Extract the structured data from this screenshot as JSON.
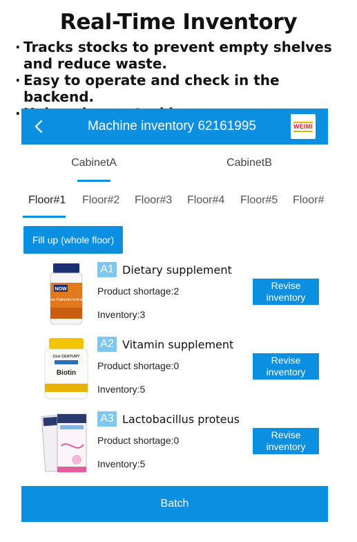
{
  "promo": {
    "title": "Real-Time Inventory",
    "bullets": [
      "Tracks stocks to prevent empty shelves and reduce waste.",
      "Easy to operate and check in the backend.",
      "Helps plan restocking"
    ]
  },
  "header": {
    "title": "Machine inventory 62161995",
    "logo_text": "WEIMI",
    "accent_color": "#0b8fe0"
  },
  "cabinet_tabs": [
    "CabinetA",
    "CabinetB"
  ],
  "selected_cabinet": "CabinetA",
  "floor_tabs": [
    "Floor#1",
    "Floor#2",
    "Floor#3",
    "Floor#4",
    "Floor#5",
    "Floor#"
  ],
  "selected_floor": "Floor#1",
  "fill_button_label": "Fill up (whole floor)",
  "products": [
    {
      "slot": "A1",
      "name": "Dietary supplement",
      "shortage": "Product shortage:2",
      "inventory": "Inventory:3",
      "revise_label": "Revise inventory",
      "image_icon": "supplement-bottle-icon",
      "image_text": [
        "NOW",
        "Saw Palmetto Extract"
      ]
    },
    {
      "slot": "A2",
      "name": "Vitamin supplement",
      "shortage": "Product shortage:0",
      "inventory": "Inventory:5",
      "revise_label": "Revise inventory",
      "image_icon": "vitamin-bottle-icon",
      "image_text": [
        "21st CENTURY",
        "Biotin"
      ]
    },
    {
      "slot": "A3",
      "name": "Lactobacillus proteus",
      "shortage": "Product shortage:0",
      "inventory": "Inventory:5",
      "revise_label": "Revise inventory",
      "image_icon": "probiotic-pack-icon",
      "image_text": []
    }
  ],
  "batch_label": "Batch"
}
